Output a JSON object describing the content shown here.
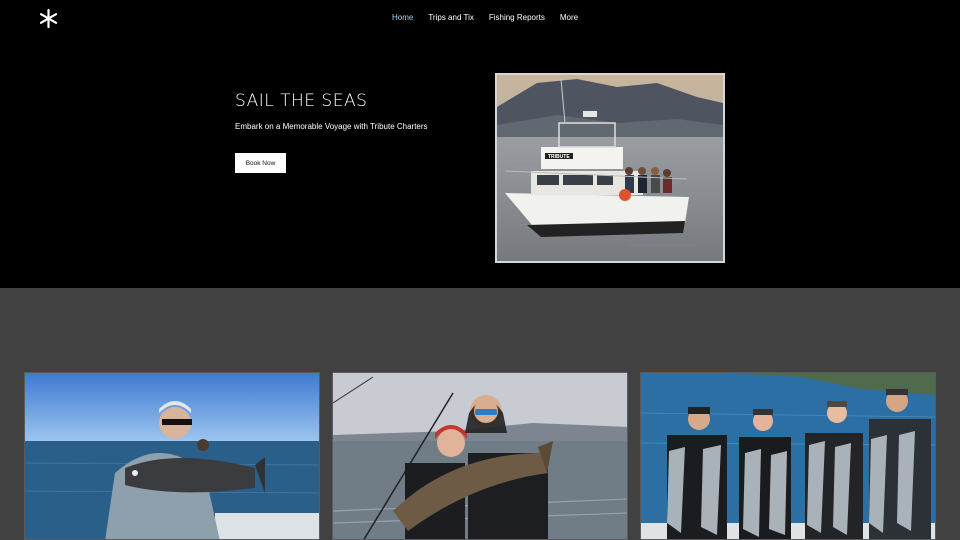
{
  "header": {
    "logo_icon": "asterisk-logo-icon",
    "nav": [
      {
        "label": "Home",
        "active": true
      },
      {
        "label": "Trips and Tix",
        "active": false
      },
      {
        "label": "Fishing Reports",
        "active": false
      },
      {
        "label": "More",
        "active": false
      }
    ]
  },
  "hero": {
    "title": "SAIL THE SEAS",
    "subtitle": "Embark on a Memorable Voyage with Tribute Charters",
    "button_label": "Book Now",
    "photo_boat_name": "TRIBUTE"
  },
  "colors": {
    "background": "#000000",
    "gallery_bg": "#414141",
    "nav_active": "#9bd3ff"
  }
}
